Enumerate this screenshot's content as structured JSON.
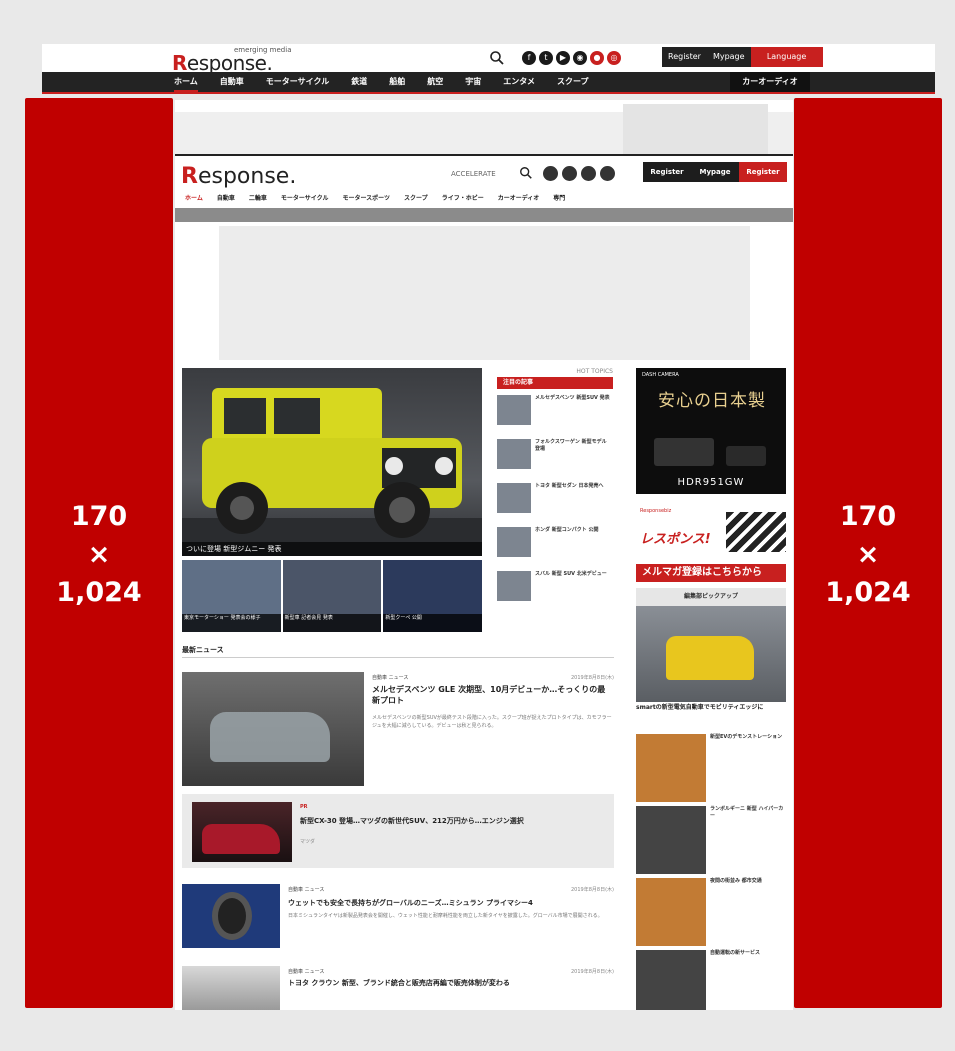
{
  "header": {
    "logo_tagline": "emerging media",
    "logo_text_r": "R",
    "logo_text_rest": "esponse.",
    "account": {
      "register": "Register",
      "mypage": "Mypage",
      "language": "Language"
    },
    "socials": [
      "facebook-icon",
      "twitter-icon",
      "youtube-icon",
      "rss-icon",
      "line-icon",
      "instagram-icon"
    ]
  },
  "nav": {
    "items": [
      "ホーム",
      "自動車",
      "モーターサイクル",
      "鉄道",
      "船舶",
      "航空",
      "宇宙",
      "エンタメ",
      "スクープ"
    ],
    "right": "カーオーディオ"
  },
  "side_ads": {
    "left": {
      "w": "170",
      "x": "×",
      "h": "1,024"
    },
    "right": {
      "w": "170",
      "x": "×",
      "h": "1,024"
    }
  },
  "inner": {
    "logo_r": "R",
    "logo_rest": "esponse.",
    "head_text": "ACCELERATE",
    "account": [
      "Register",
      "Mypage",
      "Register"
    ],
    "nav": [
      "ホーム",
      "自動車",
      "二輪車",
      "モーターサイクル",
      "モータースポーツ",
      "スクープ",
      "ライフ・ホビー",
      "カーオーディオ",
      "専門"
    ],
    "hero_caption": "ついに登場 新型ジムニー 発表",
    "thumbs": [
      "東京モーターショー 発表会の様子",
      "新型車 記者会見 発表",
      "新型クーペ 公開"
    ],
    "hot_label": "HOT TOPICS",
    "hot_title": "注目の記事",
    "hot_items": [
      "メルセデスベンツ 新型SUV 発表",
      "フォルクスワーゲン 新型モデル 登場",
      "トヨタ 新型セダン 日本発売へ",
      "ホンダ 新型コンパクト 公開",
      "スバル 新型 SUV 北米デビュー"
    ],
    "latest_title": "最新ニュース",
    "articles": {
      "a1": {
        "cat": "自動車 ニュース",
        "date": "2019年8月8日(木)",
        "head": "メルセデスベンツ GLE 次期型、10月デビューか…そっくりの最新プロト",
        "body": "メルセデスベンツの新型SUVが最終テスト段階に入った。スクープ班が捉えたプロトタイプは、カモフラージュを大幅に減らしている。デビューは秋と見られる。"
      },
      "a2": {
        "tag": "PR",
        "head": "新型CX-30 登場…マツダの新世代SUV、212万円から…エンジン選択",
        "sub": "マツダ"
      },
      "a3": {
        "cat": "自動車 ニュース",
        "date": "2019年8月8日(木)",
        "head": "ウェットでも安全で長持ちがグローバルのニーズ…ミシュラン プライマシー4",
        "body": "日本ミシュランタイヤは新製品発表会を開催し、ウェット性能と耐摩耗性能を両立した新タイヤを披露した。グローバル市場で展開される。"
      },
      "a4": {
        "cat": "自動車 ニュース",
        "date": "2019年8月8日(木)",
        "head": "トヨタ クラウン 新型、ブランド統合と販売店再編で販売体制が変わる"
      }
    },
    "right": {
      "bannerA_small": "DASH CAMERA",
      "bannerA_title": "安心の日本製",
      "bannerA_model": "HDR951GW",
      "bannerB_small": "Responsebiz",
      "bannerB_big": "レスポンス!",
      "mail": "メルマガ登録はこちらから",
      "pickup": "編集部ピックアップ",
      "pick_caption": "smartの新型電気自動車でモビリティエッジに",
      "ritems": [
        "新型EVのデモンストレーション",
        "ランボルギーニ 新型 ハイパーカー",
        "夜間の街並み 都市交通",
        "自動運転の新サービス"
      ]
    }
  }
}
